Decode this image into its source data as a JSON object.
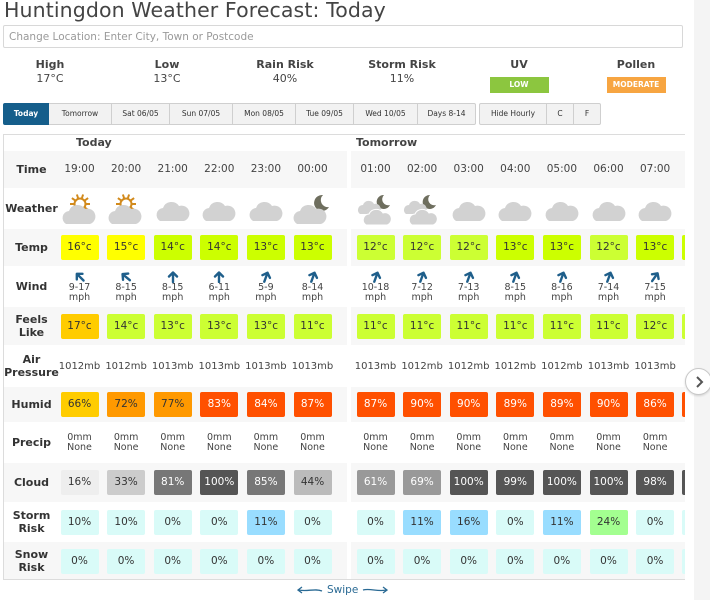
{
  "page": {
    "title": "Huntingdon Weather Forecast: Today",
    "location_placeholder": "Change Location: Enter City, Town or Postcode"
  },
  "summary": [
    {
      "label": "High",
      "value": "17°C"
    },
    {
      "label": "Low",
      "value": "13°C"
    },
    {
      "label": "Rain Risk",
      "value": "40%"
    },
    {
      "label": "Storm Risk",
      "value": "11%"
    },
    {
      "label": "UV",
      "badge": "LOW",
      "badge_color": "#8cc63f"
    },
    {
      "label": "Pollen",
      "badge": "MODERATE",
      "badge_color": "#f7a541"
    }
  ],
  "tabs": [
    {
      "label": "Today",
      "active": true
    },
    {
      "label": "Tomorrow"
    },
    {
      "label": "Sat 06/05"
    },
    {
      "label": "Sun 07/05"
    },
    {
      "label": "Mon 08/05"
    },
    {
      "label": "Tue 09/05"
    },
    {
      "label": "Wed 10/05"
    },
    {
      "label": "Days 8-14"
    }
  ],
  "options": [
    {
      "label": "Hide Hourly"
    },
    {
      "label": "C"
    },
    {
      "label": "F"
    }
  ],
  "days": [
    {
      "label": "Today"
    },
    {
      "label": "Tomorrow"
    }
  ],
  "row_labels": {
    "time": "Time",
    "weather": "Weather",
    "temp": "Temp",
    "wind": "Wind",
    "feels": "Feels Like",
    "pressure": "Air Pressure",
    "humid": "Humid",
    "precip": "Precip",
    "cloud": "Cloud",
    "storm": "Storm Risk",
    "snow": "Snow Risk"
  },
  "hours": [
    {
      "day": 0,
      "time": "19:00",
      "weather": "sun-cloud",
      "temp": "16°c",
      "temp_color": "#ffff00",
      "wind_dir": 315,
      "wind": "9-17",
      "wind_unit": "mph",
      "feels": "17°c",
      "feels_color": "#ffcc00",
      "pressure": "1012mb",
      "humid": "66%",
      "humid_color": "#ffcc00",
      "precip": "0mm",
      "precip_type": "None",
      "cloud": "16%",
      "cloud_color": "#eeeeee",
      "storm": "10%",
      "storm_color": "#d9fbf8",
      "snow": "0%",
      "snow_color": "#d9fbf8"
    },
    {
      "day": 0,
      "time": "20:00",
      "weather": "sun-cloud",
      "temp": "15°c",
      "temp_color": "#ffff00",
      "wind_dir": 310,
      "wind": "8-15",
      "wind_unit": "mph",
      "feels": "14°c",
      "feels_color": "#ccff33",
      "pressure": "1012mb",
      "humid": "72%",
      "humid_color": "#ff9900",
      "precip": "0mm",
      "precip_type": "None",
      "cloud": "33%",
      "cloud_color": "#cccccc",
      "storm": "10%",
      "storm_color": "#d9fbf8",
      "snow": "0%",
      "snow_color": "#d9fbf8"
    },
    {
      "day": 0,
      "time": "21:00",
      "weather": "cloud",
      "temp": "14°c",
      "temp_color": "#ccff00",
      "wind_dir": 0,
      "wind": "8-15",
      "wind_unit": "mph",
      "feels": "13°c",
      "feels_color": "#ccff33",
      "pressure": "1013mb",
      "humid": "77%",
      "humid_color": "#ff9900",
      "precip": "0mm",
      "precip_type": "None",
      "cloud": "81%",
      "cloud_color": "#777777",
      "storm": "0%",
      "storm_color": "#d9fbf8",
      "snow": "0%",
      "snow_color": "#d9fbf8"
    },
    {
      "day": 0,
      "time": "22:00",
      "weather": "cloud",
      "temp": "14°c",
      "temp_color": "#ccff00",
      "wind_dir": 0,
      "wind": "6-11",
      "wind_unit": "mph",
      "feels": "13°c",
      "feels_color": "#ccff33",
      "pressure": "1013mb",
      "humid": "83%",
      "humid_color": "#ff5000",
      "precip": "0mm",
      "precip_type": "None",
      "cloud": "100%",
      "cloud_color": "#555555",
      "storm": "0%",
      "storm_color": "#d9fbf8",
      "snow": "0%",
      "snow_color": "#d9fbf8"
    },
    {
      "day": 0,
      "time": "23:00",
      "weather": "cloud",
      "temp": "13°c",
      "temp_color": "#ccff00",
      "wind_dir": 20,
      "wind": "5-9",
      "wind_unit": "mph",
      "feels": "13°c",
      "feels_color": "#ccff33",
      "pressure": "1013mb",
      "humid": "84%",
      "humid_color": "#ff5000",
      "precip": "0mm",
      "precip_type": "None",
      "cloud": "85%",
      "cloud_color": "#777777",
      "storm": "11%",
      "storm_color": "#99ddff",
      "snow": "0%",
      "snow_color": "#d9fbf8"
    },
    {
      "day": 0,
      "time": "00:00",
      "weather": "moon-cloud",
      "temp": "13°c",
      "temp_color": "#ccff00",
      "wind_dir": 20,
      "wind": "8-14",
      "wind_unit": "mph",
      "feels": "11°c",
      "feels_color": "#ccff33",
      "pressure": "1013mb",
      "humid": "87%",
      "humid_color": "#ff5000",
      "precip": "0mm",
      "precip_type": "None",
      "cloud": "44%",
      "cloud_color": "#bbbbbb",
      "storm": "0%",
      "storm_color": "#d9fbf8",
      "snow": "0%",
      "snow_color": "#d9fbf8"
    },
    {
      "day": 1,
      "time": "01:00",
      "weather": "moon-clouds",
      "temp": "12°c",
      "temp_color": "#ccff33",
      "wind_dir": 20,
      "wind": "10-18",
      "wind_unit": "mph",
      "feels": "11°c",
      "feels_color": "#ccff33",
      "pressure": "1013mb",
      "humid": "87%",
      "humid_color": "#ff5000",
      "precip": "0mm",
      "precip_type": "None",
      "cloud": "61%",
      "cloud_color": "#999999",
      "storm": "0%",
      "storm_color": "#d9fbf8",
      "snow": "0%",
      "snow_color": "#d9fbf8"
    },
    {
      "day": 1,
      "time": "02:00",
      "weather": "moon-clouds",
      "temp": "12°c",
      "temp_color": "#ccff33",
      "wind_dir": 20,
      "wind": "7-12",
      "wind_unit": "mph",
      "feels": "11°c",
      "feels_color": "#ccff33",
      "pressure": "1012mb",
      "humid": "90%",
      "humid_color": "#ff5000",
      "precip": "0mm",
      "precip_type": "None",
      "cloud": "69%",
      "cloud_color": "#999999",
      "storm": "11%",
      "storm_color": "#99ddff",
      "snow": "0%",
      "snow_color": "#d9fbf8"
    },
    {
      "day": 1,
      "time": "03:00",
      "weather": "cloud",
      "temp": "12°c",
      "temp_color": "#ccff33",
      "wind_dir": 20,
      "wind": "7-13",
      "wind_unit": "mph",
      "feels": "11°c",
      "feels_color": "#ccff33",
      "pressure": "1012mb",
      "humid": "90%",
      "humid_color": "#ff5000",
      "precip": "0mm",
      "precip_type": "None",
      "cloud": "100%",
      "cloud_color": "#555555",
      "storm": "16%",
      "storm_color": "#99ddff",
      "snow": "0%",
      "snow_color": "#d9fbf8"
    },
    {
      "day": 1,
      "time": "04:00",
      "weather": "cloud",
      "temp": "13°c",
      "temp_color": "#ccff00",
      "wind_dir": 20,
      "wind": "8-15",
      "wind_unit": "mph",
      "feels": "11°c",
      "feels_color": "#ccff33",
      "pressure": "1012mb",
      "humid": "89%",
      "humid_color": "#ff5000",
      "precip": "0mm",
      "precip_type": "None",
      "cloud": "99%",
      "cloud_color": "#555555",
      "storm": "0%",
      "storm_color": "#d9fbf8",
      "snow": "0%",
      "snow_color": "#d9fbf8"
    },
    {
      "day": 1,
      "time": "05:00",
      "weather": "cloud",
      "temp": "13°c",
      "temp_color": "#ccff00",
      "wind_dir": 20,
      "wind": "8-16",
      "wind_unit": "mph",
      "feels": "11°c",
      "feels_color": "#ccff33",
      "pressure": "1012mb",
      "humid": "89%",
      "humid_color": "#ff5000",
      "precip": "0mm",
      "precip_type": "None",
      "cloud": "100%",
      "cloud_color": "#555555",
      "storm": "11%",
      "storm_color": "#99ddff",
      "snow": "0%",
      "snow_color": "#d9fbf8"
    },
    {
      "day": 1,
      "time": "06:00",
      "weather": "cloud",
      "temp": "12°c",
      "temp_color": "#ccff33",
      "wind_dir": 20,
      "wind": "7-14",
      "wind_unit": "mph",
      "feels": "11°c",
      "feels_color": "#ccff33",
      "pressure": "1013mb",
      "humid": "90%",
      "humid_color": "#ff5000",
      "precip": "0mm",
      "precip_type": "None",
      "cloud": "100%",
      "cloud_color": "#555555",
      "storm": "24%",
      "storm_color": "#a3ff90",
      "snow": "0%",
      "snow_color": "#d9fbf8"
    },
    {
      "day": 1,
      "time": "07:00",
      "weather": "cloud",
      "temp": "13°c",
      "temp_color": "#ccff00",
      "wind_dir": 35,
      "wind": "7-15",
      "wind_unit": "mph",
      "feels": "12°c",
      "feels_color": "#ccff33",
      "pressure": "1013mb",
      "humid": "86%",
      "humid_color": "#ff5000",
      "precip": "0mm",
      "precip_type": "None",
      "cloud": "98%",
      "cloud_color": "#555555",
      "storm": "0%",
      "storm_color": "#d9fbf8",
      "snow": "0%",
      "snow_color": "#d9fbf8"
    }
  ],
  "partial_column": {
    "temp_color": "#ccff00",
    "humid_color": "#ff5000",
    "cloud_color": "#555555",
    "storm_color": "#d9fbf8",
    "snow_color": "#d9fbf8"
  },
  "swipe": {
    "label": "Swipe"
  },
  "icons": {
    "next": "chevron-right-icon"
  }
}
